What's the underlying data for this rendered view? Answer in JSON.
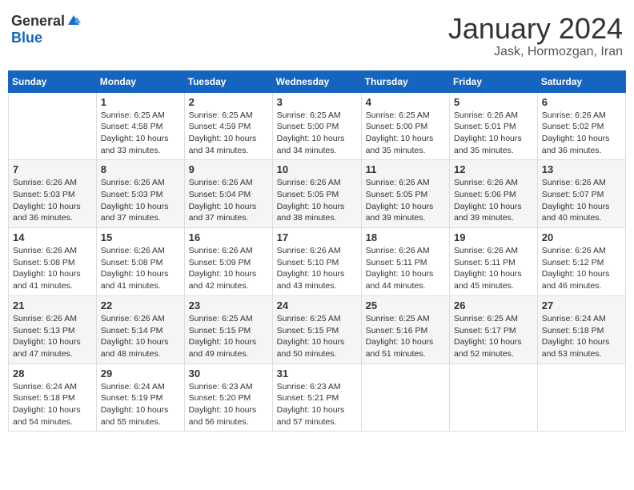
{
  "logo": {
    "general_text": "General",
    "blue_text": "Blue"
  },
  "header": {
    "month_year": "January 2024",
    "location": "Jask, Hormozgan, Iran"
  },
  "days_of_week": [
    "Sunday",
    "Monday",
    "Tuesday",
    "Wednesday",
    "Thursday",
    "Friday",
    "Saturday"
  ],
  "weeks": [
    [
      {
        "day": "",
        "info": ""
      },
      {
        "day": "1",
        "info": "Sunrise: 6:25 AM\nSunset: 4:58 PM\nDaylight: 10 hours\nand 33 minutes."
      },
      {
        "day": "2",
        "info": "Sunrise: 6:25 AM\nSunset: 4:59 PM\nDaylight: 10 hours\nand 34 minutes."
      },
      {
        "day": "3",
        "info": "Sunrise: 6:25 AM\nSunset: 5:00 PM\nDaylight: 10 hours\nand 34 minutes."
      },
      {
        "day": "4",
        "info": "Sunrise: 6:25 AM\nSunset: 5:00 PM\nDaylight: 10 hours\nand 35 minutes."
      },
      {
        "day": "5",
        "info": "Sunrise: 6:26 AM\nSunset: 5:01 PM\nDaylight: 10 hours\nand 35 minutes."
      },
      {
        "day": "6",
        "info": "Sunrise: 6:26 AM\nSunset: 5:02 PM\nDaylight: 10 hours\nand 36 minutes."
      }
    ],
    [
      {
        "day": "7",
        "info": "Sunrise: 6:26 AM\nSunset: 5:03 PM\nDaylight: 10 hours\nand 36 minutes."
      },
      {
        "day": "8",
        "info": "Sunrise: 6:26 AM\nSunset: 5:03 PM\nDaylight: 10 hours\nand 37 minutes."
      },
      {
        "day": "9",
        "info": "Sunrise: 6:26 AM\nSunset: 5:04 PM\nDaylight: 10 hours\nand 37 minutes."
      },
      {
        "day": "10",
        "info": "Sunrise: 6:26 AM\nSunset: 5:05 PM\nDaylight: 10 hours\nand 38 minutes."
      },
      {
        "day": "11",
        "info": "Sunrise: 6:26 AM\nSunset: 5:05 PM\nDaylight: 10 hours\nand 39 minutes."
      },
      {
        "day": "12",
        "info": "Sunrise: 6:26 AM\nSunset: 5:06 PM\nDaylight: 10 hours\nand 39 minutes."
      },
      {
        "day": "13",
        "info": "Sunrise: 6:26 AM\nSunset: 5:07 PM\nDaylight: 10 hours\nand 40 minutes."
      }
    ],
    [
      {
        "day": "14",
        "info": "Sunrise: 6:26 AM\nSunset: 5:08 PM\nDaylight: 10 hours\nand 41 minutes."
      },
      {
        "day": "15",
        "info": "Sunrise: 6:26 AM\nSunset: 5:08 PM\nDaylight: 10 hours\nand 41 minutes."
      },
      {
        "day": "16",
        "info": "Sunrise: 6:26 AM\nSunset: 5:09 PM\nDaylight: 10 hours\nand 42 minutes."
      },
      {
        "day": "17",
        "info": "Sunrise: 6:26 AM\nSunset: 5:10 PM\nDaylight: 10 hours\nand 43 minutes."
      },
      {
        "day": "18",
        "info": "Sunrise: 6:26 AM\nSunset: 5:11 PM\nDaylight: 10 hours\nand 44 minutes."
      },
      {
        "day": "19",
        "info": "Sunrise: 6:26 AM\nSunset: 5:11 PM\nDaylight: 10 hours\nand 45 minutes."
      },
      {
        "day": "20",
        "info": "Sunrise: 6:26 AM\nSunset: 5:12 PM\nDaylight: 10 hours\nand 46 minutes."
      }
    ],
    [
      {
        "day": "21",
        "info": "Sunrise: 6:26 AM\nSunset: 5:13 PM\nDaylight: 10 hours\nand 47 minutes."
      },
      {
        "day": "22",
        "info": "Sunrise: 6:26 AM\nSunset: 5:14 PM\nDaylight: 10 hours\nand 48 minutes."
      },
      {
        "day": "23",
        "info": "Sunrise: 6:25 AM\nSunset: 5:15 PM\nDaylight: 10 hours\nand 49 minutes."
      },
      {
        "day": "24",
        "info": "Sunrise: 6:25 AM\nSunset: 5:15 PM\nDaylight: 10 hours\nand 50 minutes."
      },
      {
        "day": "25",
        "info": "Sunrise: 6:25 AM\nSunset: 5:16 PM\nDaylight: 10 hours\nand 51 minutes."
      },
      {
        "day": "26",
        "info": "Sunrise: 6:25 AM\nSunset: 5:17 PM\nDaylight: 10 hours\nand 52 minutes."
      },
      {
        "day": "27",
        "info": "Sunrise: 6:24 AM\nSunset: 5:18 PM\nDaylight: 10 hours\nand 53 minutes."
      }
    ],
    [
      {
        "day": "28",
        "info": "Sunrise: 6:24 AM\nSunset: 5:18 PM\nDaylight: 10 hours\nand 54 minutes."
      },
      {
        "day": "29",
        "info": "Sunrise: 6:24 AM\nSunset: 5:19 PM\nDaylight: 10 hours\nand 55 minutes."
      },
      {
        "day": "30",
        "info": "Sunrise: 6:23 AM\nSunset: 5:20 PM\nDaylight: 10 hours\nand 56 minutes."
      },
      {
        "day": "31",
        "info": "Sunrise: 6:23 AM\nSunset: 5:21 PM\nDaylight: 10 hours\nand 57 minutes."
      },
      {
        "day": "",
        "info": ""
      },
      {
        "day": "",
        "info": ""
      },
      {
        "day": "",
        "info": ""
      }
    ]
  ]
}
